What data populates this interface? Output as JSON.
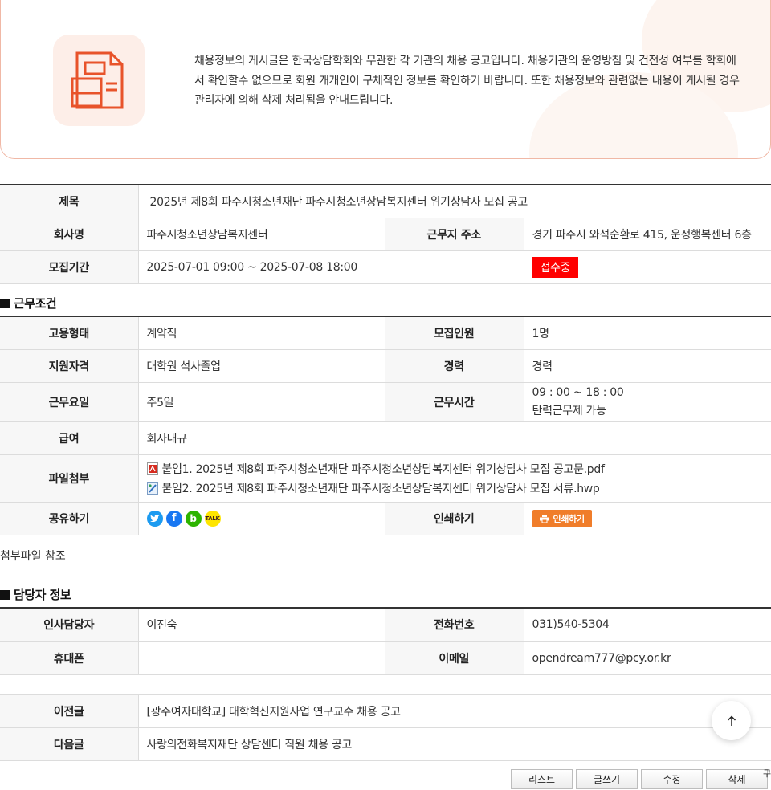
{
  "notice": {
    "icon": "document-icon",
    "text": "채용정보의 게시글은 한국상담학회와 무관한 각 기관의 채용 공고입니다. 채용기관의 운영방침 및 건전성 여부를 학회에서 확인할수 없으므로 회원 개개인이 구체적인 정보를 확인하기 바랍니다. 또한 채용정보와 관련없는 내용이 게시될 경우 관리자에 의해 삭제 처리됨을 안내드립니다."
  },
  "post": {
    "title_label": "제목",
    "title": "2025년 제8회 파주시청소년재단 파주시청소년상담복지센터 위기상담사 모집 공고",
    "company_label": "회사명",
    "company": "파주시청소년상담복지센터",
    "address_label": "근무지 주소",
    "address": "경기 파주시 와석순환로 415, 운정행복센터 6층",
    "period_label": "모집기간",
    "period": "2025-07-01 09:00 ~ 2025-07-08 18:00",
    "status": "접수중"
  },
  "conditions": {
    "section_title": "근무조건",
    "employment_type_label": "고용형태",
    "employment_type": "계약직",
    "headcount_label": "모집인원",
    "headcount": "1명",
    "qualification_label": "지원자격",
    "qualification": "대학원 석사졸업",
    "career_label": "경력",
    "career": "경력",
    "workdays_label": "근무요일",
    "workdays": "주5일",
    "worktime_label": "근무시간",
    "worktime_1": "09 : 00 ~ 18 : 00",
    "worktime_2": "탄력근무제 가능",
    "salary_label": "급여",
    "salary": "회사내규",
    "files_label": "파일첨부",
    "file_1": "붙임1. 2025년 제8회 파주시청소년재단 파주시청소년상담복지센터 위기상담사 모집 공고문.pdf",
    "file_2": "붙임2. 2025년 제8회 파주시청소년재단 파주시청소년상담복지센터 위기상담사 모집 서류.hwp",
    "share_label": "공유하기",
    "print_label": "인쇄하기",
    "print_button": "인쇄하기"
  },
  "note": "첨부파일 참조",
  "contact": {
    "section_title": "담당자 정보",
    "manager_label": "인사담당자",
    "manager": "이진숙",
    "phone_label": "전화번호",
    "phone": "031)540-5304",
    "mobile_label": "휴대폰",
    "mobile": "",
    "email_label": "이메일",
    "email": "opendream777@pcy.or.kr"
  },
  "nav": {
    "prev_label": "이전글",
    "prev": "[광주여자대학교] 대학혁신지원사업 연구교수 채용 공고",
    "next_label": "다음글",
    "next": "사랑의전화복지재단 상담센터 직원 채용 공고"
  },
  "buttons": {
    "list": "리스트",
    "write": "글쓰기",
    "edit": "수정",
    "delete": "삭제"
  },
  "edge_text": "쿠"
}
